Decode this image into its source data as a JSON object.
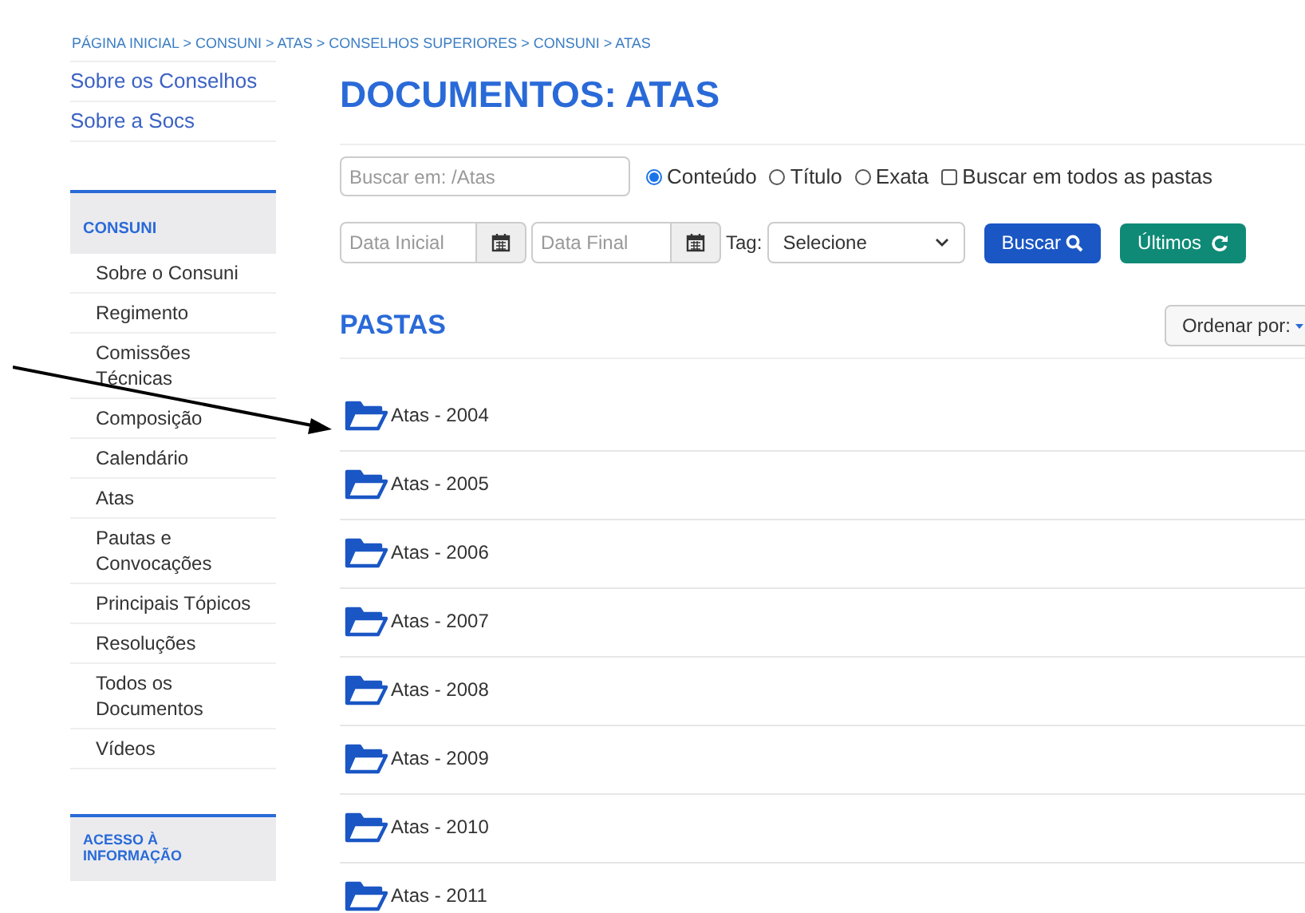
{
  "breadcrumb": "PÁGINA INICIAL > CONSUNI > ATAS > CONSELHOS SUPERIORES > CONSUNI > ATAS",
  "top_links": [
    "Sobre os Conselhos",
    "Sobre a Socs"
  ],
  "sidebar": {
    "title": "CONSUNI",
    "items": [
      "Sobre o Consuni",
      "Regimento",
      "Comissões Técnicas",
      "Composição",
      "Calendário",
      "Atas",
      "Pautas e Convocações",
      "Principais Tópicos",
      "Resoluções",
      "Todos os Documentos",
      "Vídeos"
    ]
  },
  "sidebar2": {
    "title": "ACESSO À INFORMAÇÃO"
  },
  "page_title": "DOCUMENTOS: ATAS",
  "search": {
    "placeholder": "Buscar em: /Atas",
    "modes": [
      {
        "label": "Conteúdo",
        "selected": true
      },
      {
        "label": "Título",
        "selected": false
      },
      {
        "label": "Exata",
        "selected": false
      }
    ],
    "all_folders": {
      "label": "Buscar em todos as pastas",
      "checked": false
    },
    "date_start": {
      "placeholder": "Data Inicial"
    },
    "date_end": {
      "placeholder": "Data Final"
    },
    "tag_label": "Tag:",
    "tag_value": "Selecione",
    "search_button": "Buscar",
    "latest_button": "Últimos"
  },
  "folders_title": "PASTAS",
  "sort_button": "Ordenar por:",
  "folders": [
    "Atas - 2004",
    "Atas - 2005",
    "Atas - 2006",
    "Atas - 2007",
    "Atas - 2008",
    "Atas - 2009",
    "Atas - 2010",
    "Atas - 2011"
  ]
}
